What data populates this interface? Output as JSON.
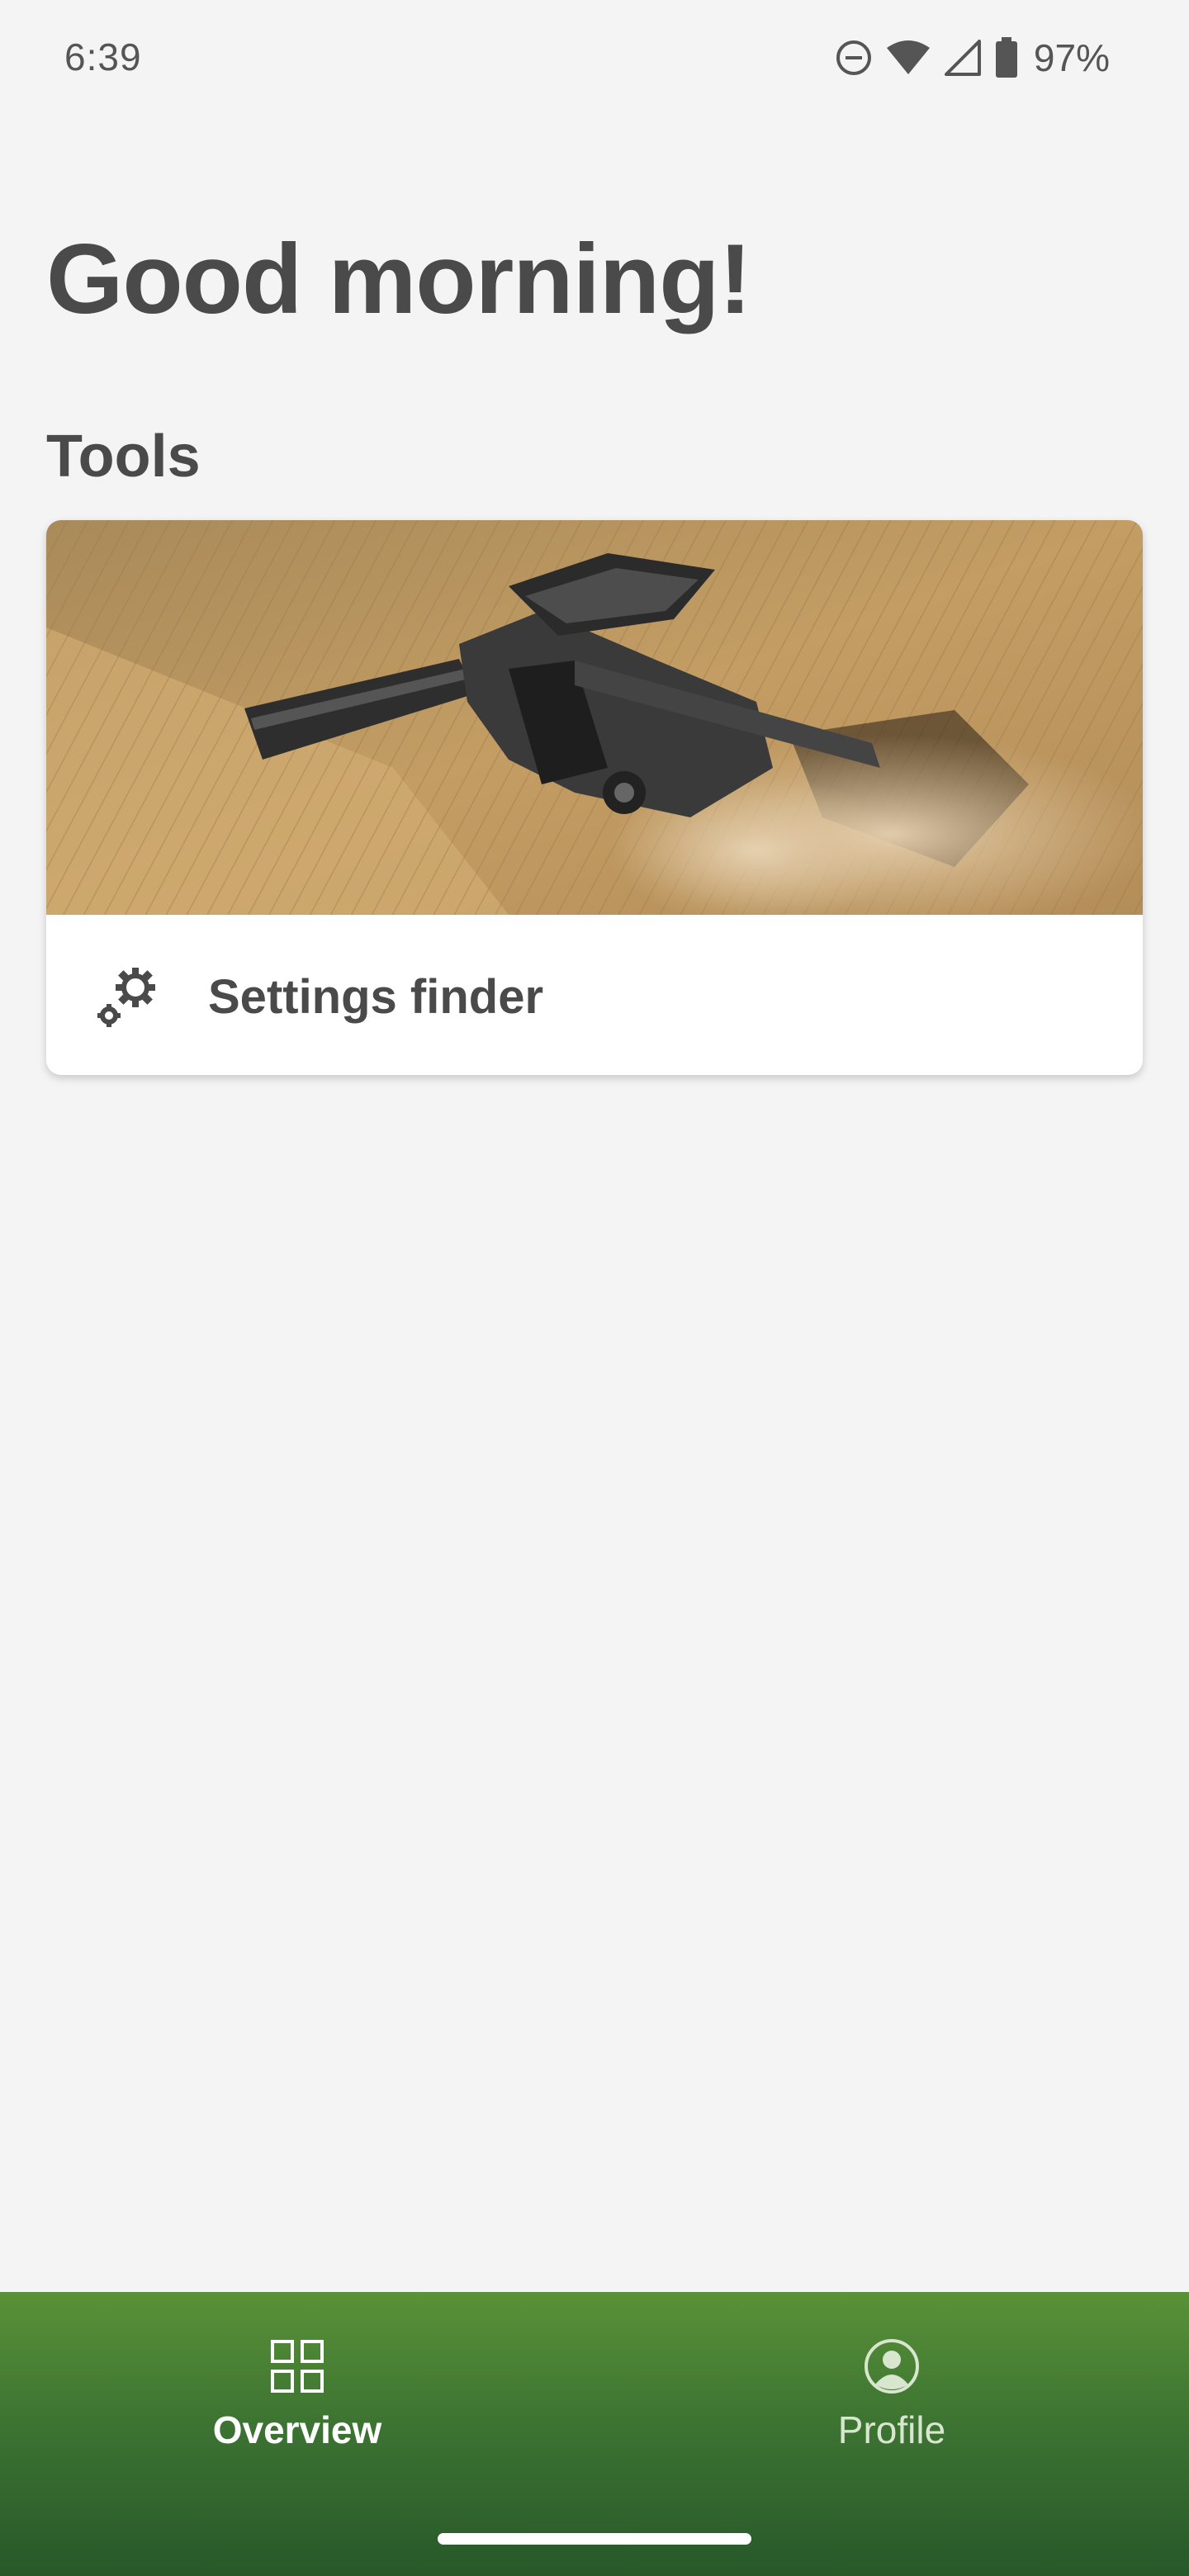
{
  "status_bar": {
    "time": "6:39",
    "battery_percent": "97%",
    "icons": [
      "do-not-disturb-icon",
      "wifi-icon",
      "signal-icon",
      "battery-icon"
    ]
  },
  "greeting": "Good morning!",
  "tools": {
    "section_title": "Tools",
    "card": {
      "label": "Settings finder",
      "icon": "gears-icon",
      "image": "combine-harvester-photo"
    }
  },
  "bottom_nav": {
    "items": [
      {
        "label": "Overview",
        "icon": "grid-icon",
        "active": true
      },
      {
        "label": "Profile",
        "icon": "profile-icon",
        "active": false
      }
    ]
  },
  "colors": {
    "background": "#f4f4f4",
    "text": "#4a4a4a",
    "nav_top": "#5a9238",
    "nav_bottom": "#27582a"
  }
}
